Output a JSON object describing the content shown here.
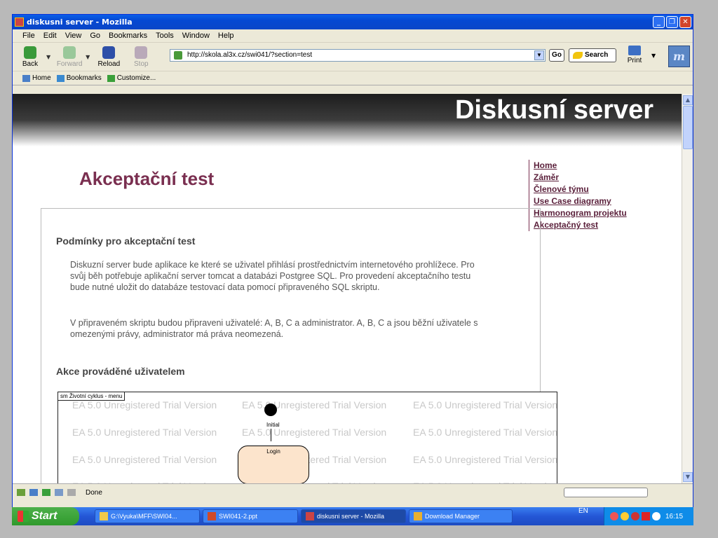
{
  "window": {
    "title": "diskusni server - Mozilla"
  },
  "menubar": [
    "File",
    "Edit",
    "View",
    "Go",
    "Bookmarks",
    "Tools",
    "Window",
    "Help"
  ],
  "navbar": {
    "back": "Back",
    "forward": "Forward",
    "reload": "Reload",
    "stop": "Stop",
    "url": "http://skola.al3x.cz/swi041/?section=test",
    "go": "Go",
    "search": "Search",
    "print": "Print"
  },
  "personal": {
    "home": "Home",
    "bookmarks": "Bookmarks",
    "customize": "Customize..."
  },
  "page": {
    "site_title": "Diskusní server",
    "title": "Akceptační test",
    "nav": [
      "Home",
      "Záměr",
      "Členové týmu",
      "Use Case diagramy",
      "Harmonogram projektu",
      "Akceptačný test"
    ],
    "section1": "Podmínky pro akceptační test",
    "para1_line1": "Diskuzní server bude aplikace ke které se uživatel přihlásí prostřednictvím internetového prohlížece. Pro",
    "para1_line2": "svůj běh potřebuje aplikační server tomcat a databázi Postgree SQL. Pro provedení akceptačního testu",
    "para1_line3": "bude nutné uložit do databáze testovací data pomocí připraveného SQL skriptu.",
    "para2_line1": "V připraveném skriptu budou připraveni uživatelé: A, B, C a administrator. A, B, C a jsou běžní uživatele s",
    "para2_line2": "omezenými právy, administrator má práva neomezená.",
    "section2": "Akce prováděné uživatelem",
    "diagram": {
      "tag": "sm Životní cyklus - menu",
      "watermark": "EA 5.0 Unregistered Trial Version",
      "initial_label": "Initial",
      "state_label": "Login"
    }
  },
  "status": {
    "text": "Done"
  },
  "taskbar": {
    "start": "Start",
    "tasks": [
      "G:\\Vyuka\\MFF\\SWI04...",
      "SWI041-2.ppt",
      "diskusni server - Mozilla",
      "Download Manager"
    ],
    "lang": "EN",
    "clock": "16:15"
  }
}
